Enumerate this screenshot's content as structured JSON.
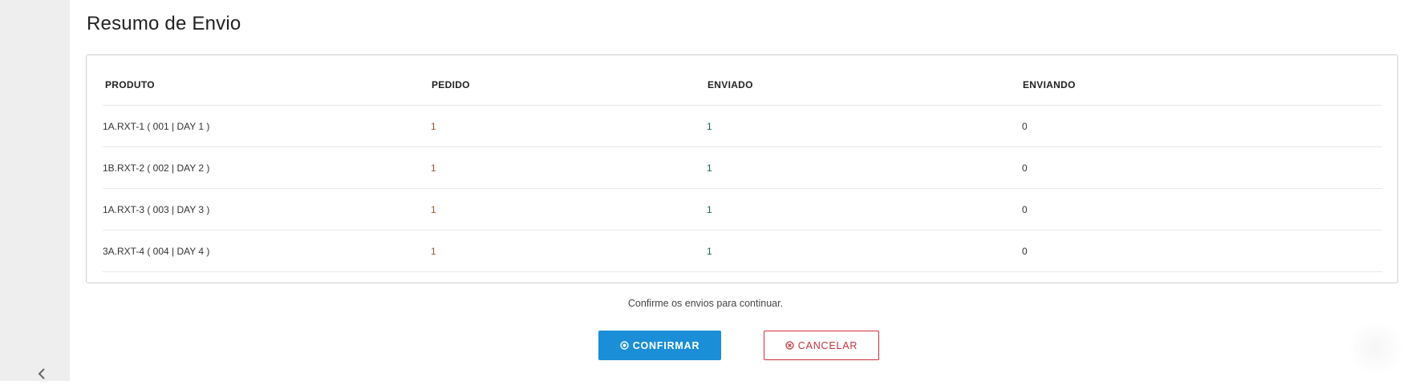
{
  "page": {
    "title": "Resumo de Envio"
  },
  "table": {
    "headers": {
      "produto": "PRODUTO",
      "pedido": "PEDIDO",
      "enviado": "ENVIADO",
      "enviando": "ENVIANDO"
    },
    "rows": [
      {
        "produto": "1A.RXT-1 ( 001 | DAY 1 )",
        "pedido": "1",
        "enviado": "1",
        "enviando": "0"
      },
      {
        "produto": "1B.RXT-2 ( 002 | DAY 2 )",
        "pedido": "1",
        "enviado": "1",
        "enviando": "0"
      },
      {
        "produto": "1A.RXT-3 ( 003 | DAY 3 )",
        "pedido": "1",
        "enviado": "1",
        "enviando": "0"
      },
      {
        "produto": "3A.RXT-4 ( 004 | DAY 4 )",
        "pedido": "1",
        "enviado": "1",
        "enviando": "0"
      }
    ]
  },
  "footer": {
    "hint": "Confirme os envios para continuar.",
    "confirm_label": "CONFIRMAR",
    "cancel_label": "CANCELAR"
  },
  "icons": {
    "sidebar_toggle": "chevron-left-icon",
    "confirm": "circle-check-icon",
    "cancel": "circle-x-icon"
  },
  "colors": {
    "primary": "#1a8ed6",
    "danger": "#c8323c",
    "sidebar_bg": "#eeeeee"
  }
}
